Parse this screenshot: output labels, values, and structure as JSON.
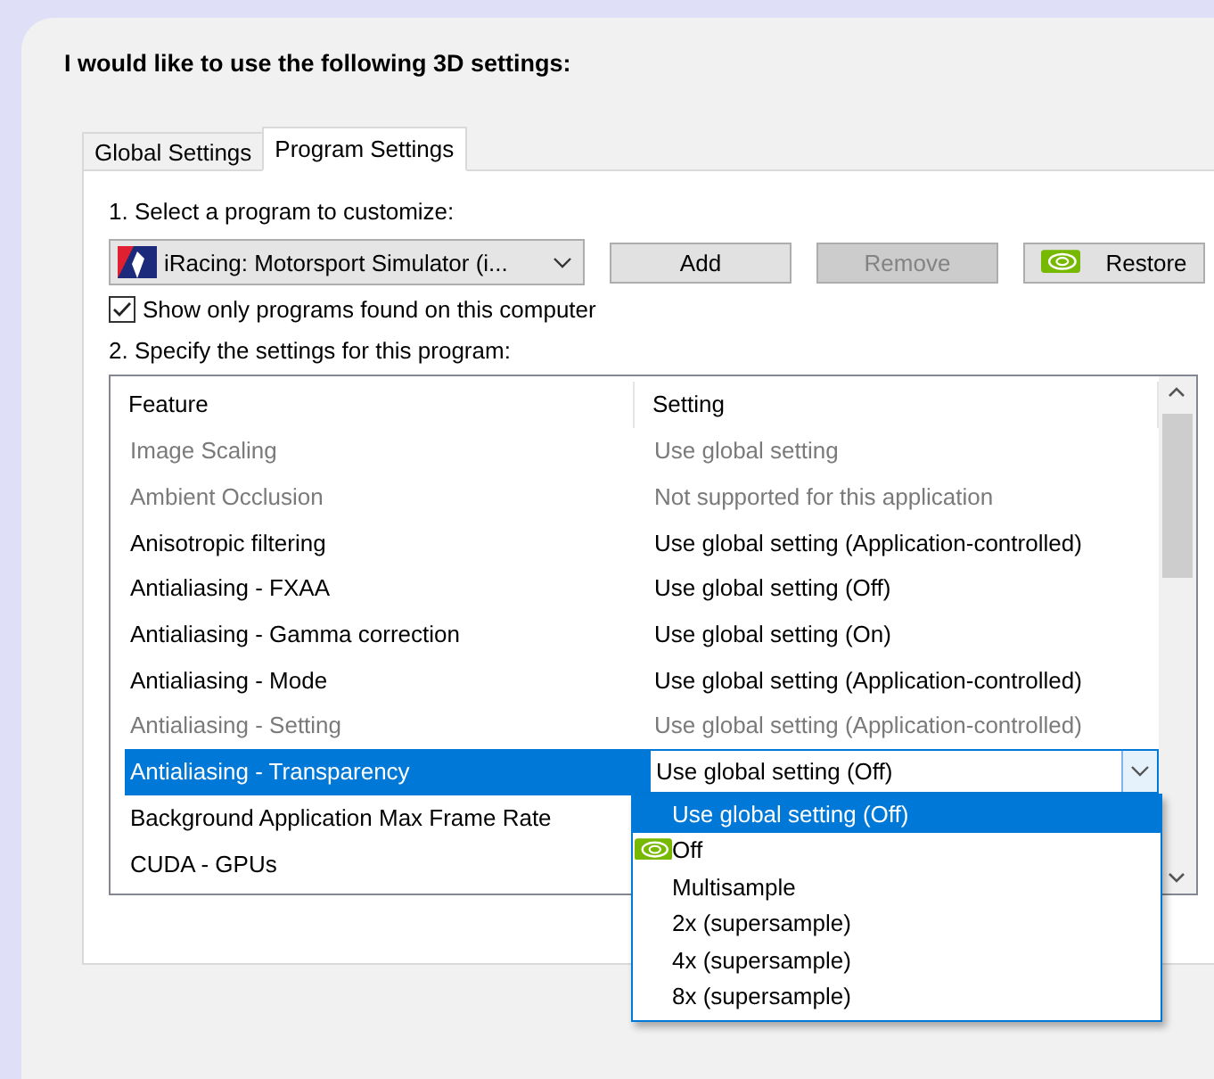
{
  "heading": "I would like to use the following 3D settings:",
  "tabs": [
    {
      "label": "Global Settings",
      "selected": false
    },
    {
      "label": "Program Settings",
      "selected": true
    }
  ],
  "program_label": "1. Select a program to customize:",
  "program_select": {
    "value": "iRacing: Motorsport Simulator (i..."
  },
  "buttons": [
    {
      "label": "Add",
      "disabled": false,
      "has_icon": false
    },
    {
      "label": "Remove",
      "disabled": true,
      "has_icon": false
    },
    {
      "label": "Restore",
      "disabled": false,
      "has_icon": true
    }
  ],
  "show_only_checkbox": {
    "label": "Show only programs found on this computer",
    "checked": true
  },
  "settings_label": "2. Specify the settings for this program:",
  "table": {
    "columns": [
      "Feature",
      "Setting"
    ],
    "rows": [
      {
        "feature": "Image Scaling",
        "setting": "Use global setting",
        "disabled": true,
        "selected": false
      },
      {
        "feature": "Ambient Occlusion",
        "setting": "Not supported for this application",
        "disabled": true,
        "selected": false
      },
      {
        "feature": "Anisotropic filtering",
        "setting": "Use global setting (Application-controlled)",
        "disabled": false,
        "selected": false
      },
      {
        "feature": "Antialiasing - FXAA",
        "setting": "Use global setting (Off)",
        "disabled": false,
        "selected": false
      },
      {
        "feature": "Antialiasing - Gamma correction",
        "setting": "Use global setting (On)",
        "disabled": false,
        "selected": false
      },
      {
        "feature": "Antialiasing - Mode",
        "setting": "Use global setting (Application-controlled)",
        "disabled": false,
        "selected": false
      },
      {
        "feature": "Antialiasing - Setting",
        "setting": "Use global setting (Application-controlled)",
        "disabled": true,
        "selected": false
      },
      {
        "feature": "Antialiasing - Transparency",
        "setting": "Use global setting (Off)",
        "disabled": false,
        "selected": true
      },
      {
        "feature": "Background Application Max Frame Rate",
        "disabled": false,
        "selected": false
      },
      {
        "feature": "CUDA - GPUs",
        "disabled": false,
        "selected": false
      }
    ]
  },
  "dropdown": {
    "options": [
      {
        "label": "Use global setting (Off)",
        "selected": true,
        "has_icon": false
      },
      {
        "label": "Off",
        "selected": false,
        "has_icon": true
      },
      {
        "label": "Multisample",
        "selected": false,
        "has_icon": false
      },
      {
        "label": "2x (supersample)",
        "selected": false,
        "has_icon": false
      },
      {
        "label": "4x (supersample)",
        "selected": false,
        "has_icon": false
      },
      {
        "label": "8x (supersample)",
        "selected": false,
        "has_icon": false
      }
    ]
  }
}
